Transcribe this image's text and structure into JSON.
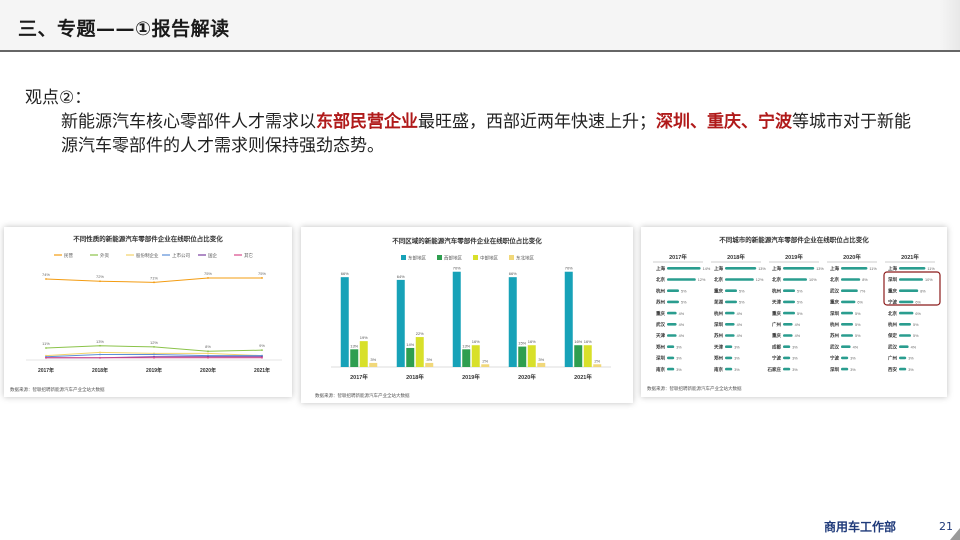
{
  "header": {
    "title": "三、专题——①报告解读"
  },
  "viewpoint": {
    "label": "观点②：",
    "part1": "新能源汽车核心零部件人才需求以",
    "highlight1": "东部民营企业",
    "part2": "最旺盛，西部近两年快速上升；",
    "highlight2": "深圳、重庆、宁波",
    "part3": "等城市对于新能源汽车零部件的人才需求则保持强劲态势。"
  },
  "colors": {
    "highlight": "#b01a1a",
    "teal": "#17a2b8",
    "green": "#3cb44b",
    "yellow": "#e6e600",
    "lightyellow": "#f3e56a"
  },
  "charts": [
    {
      "type": "line",
      "title": "不同性质的新能源汽车零部件企业在线职位占比变化",
      "legend": [
        "民营",
        "外资",
        "股份制企业",
        "上市公司",
        "国企",
        "其它"
      ],
      "categories": [
        "2017年",
        "2018年",
        "2019年",
        "2020年",
        "2021年"
      ],
      "series": [
        {
          "name": "民营",
          "values": [
            74,
            72,
            71,
            75,
            75
          ]
        },
        {
          "name": "外资",
          "values": [
            11,
            13,
            12,
            8,
            9
          ]
        },
        {
          "name": "股份制企业",
          "values": [
            4,
            7,
            6,
            6,
            4
          ]
        },
        {
          "name": "上市公司",
          "values": [
            3,
            5,
            5,
            4,
            4
          ]
        },
        {
          "name": "国企",
          "values": [
            2,
            2,
            3,
            3,
            3
          ]
        },
        {
          "name": "其它",
          "values": [
            2,
            2,
            2,
            2,
            2
          ]
        }
      ],
      "data_labels": [
        [
          "74%",
          "72%",
          "71%",
          "75%",
          "75%"
        ],
        [
          "11%",
          "13%",
          "12%",
          "8%",
          "9%"
        ],
        [
          "4%",
          "7%",
          "6%",
          "6%",
          "4%"
        ],
        [
          "3%",
          "5%",
          "5%",
          "4%",
          "4%"
        ],
        [
          "2%",
          "2%",
          "3%",
          "3%",
          "3%"
        ],
        [
          "2%",
          "2%",
          "2%",
          "2%",
          "2%"
        ]
      ],
      "source": "数据来源：智联招聘新能源汽车产业全站大数据"
    },
    {
      "type": "bar",
      "title": "不同区域的新能源汽车零部件企业在线职位占比变化",
      "legend": [
        "东部地区",
        "西部地区",
        "中部地区",
        "东北地区"
      ],
      "categories": [
        "2017年",
        "2018年",
        "2019年",
        "2020年",
        "2021年"
      ],
      "series": [
        {
          "name": "东部地区",
          "values": [
            66,
            64,
            70,
            66,
            70
          ]
        },
        {
          "name": "西部地区",
          "values": [
            13,
            14,
            13,
            15,
            16
          ]
        },
        {
          "name": "中部地区",
          "values": [
            19,
            22,
            16,
            16,
            16
          ]
        },
        {
          "name": "东北地区",
          "values": [
            3,
            3,
            2,
            3,
            2
          ]
        }
      ],
      "source": "数据来源：智联招聘新能源汽车产业全站大数据"
    },
    {
      "type": "table",
      "title": "不同城市的新能源汽车零部件企业在线职位占比变化",
      "years": [
        "2017年",
        "2018年",
        "2019年",
        "2020年",
        "2021年"
      ],
      "columns": [
        [
          [
            "上海",
            "14%"
          ],
          [
            "北京",
            "12%"
          ],
          [
            "杭州",
            "5%"
          ],
          [
            "苏州",
            "5%"
          ],
          [
            "重庆",
            "4%"
          ],
          [
            "武汉",
            "4%"
          ],
          [
            "天津",
            "4%"
          ],
          [
            "郑州",
            "3%"
          ],
          [
            "深圳",
            "3%"
          ],
          [
            "南京",
            "3%"
          ]
        ],
        [
          [
            "上海",
            "13%"
          ],
          [
            "北京",
            "12%"
          ],
          [
            "重庆",
            "5%"
          ],
          [
            "芜湖",
            "5%"
          ],
          [
            "杭州",
            "4%"
          ],
          [
            "深圳",
            "4%"
          ],
          [
            "苏州",
            "4%"
          ],
          [
            "天津",
            "3%"
          ],
          [
            "郑州",
            "3%"
          ],
          [
            "南京",
            "3%"
          ]
        ],
        [
          [
            "上海",
            "13%"
          ],
          [
            "北京",
            "10%"
          ],
          [
            "杭州",
            "5%"
          ],
          [
            "天津",
            "5%"
          ],
          [
            "重庆",
            "5%"
          ],
          [
            "广州",
            "4%"
          ],
          [
            "重庆",
            "4%"
          ],
          [
            "成都",
            "3%"
          ],
          [
            "宁波",
            "3%"
          ],
          [
            "石家庄",
            "3%"
          ]
        ],
        [
          [
            "上海",
            "11%"
          ],
          [
            "北京",
            "8%"
          ],
          [
            "武汉",
            "7%"
          ],
          [
            "重庆",
            "6%"
          ],
          [
            "深圳",
            "5%"
          ],
          [
            "杭州",
            "5%"
          ],
          [
            "苏州",
            "5%"
          ],
          [
            "武汉",
            "4%"
          ],
          [
            "宁波",
            "3%"
          ],
          [
            "深圳",
            "3%"
          ]
        ],
        [
          [
            "上海",
            "11%"
          ],
          [
            "深圳",
            "10%"
          ],
          [
            "重庆",
            "8%"
          ],
          [
            "宁波",
            "6%"
          ],
          [
            "北京",
            "6%"
          ],
          [
            "杭州",
            "5%"
          ],
          [
            "保定",
            "5%"
          ],
          [
            "武汉",
            "4%"
          ],
          [
            "广州",
            "3%"
          ],
          [
            "西安",
            "3%"
          ]
        ]
      ],
      "source": "数据来源：智联招聘新能源汽车产业全站大数据"
    }
  ],
  "footer": {
    "department": "商用车工作部",
    "page": "21"
  }
}
